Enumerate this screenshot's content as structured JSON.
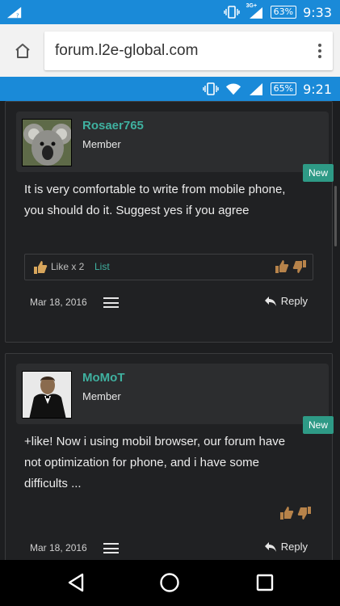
{
  "statusbar_top": {
    "network": "3G+",
    "battery": "63%",
    "time": "9:33"
  },
  "browser": {
    "url": "forum.l2e-global.com"
  },
  "statusbar_inner": {
    "battery": "65%",
    "time": "9:21"
  },
  "posts": [
    {
      "username": "Rosaer765",
      "title": "Member",
      "badge": "New",
      "message": "It is very comfortable to write from mobile phone, you should do it. Suggest yes if you agree",
      "likes": "Like x 2",
      "list_label": "List",
      "date": "Mar 18, 2016",
      "reply": "Reply"
    },
    {
      "username": "MoMoT",
      "title": "Member",
      "badge": "New",
      "message": "+like! Now i using mobil browser, our forum have not optimization for phone, and i have some difficults ...",
      "date": "Mar 18, 2016",
      "reply": "Reply"
    }
  ],
  "colors": {
    "accent": "#3fb1a0",
    "statusbar": "#1a8ad8",
    "badge": "#2e9a86",
    "background": "#1d1e20"
  }
}
